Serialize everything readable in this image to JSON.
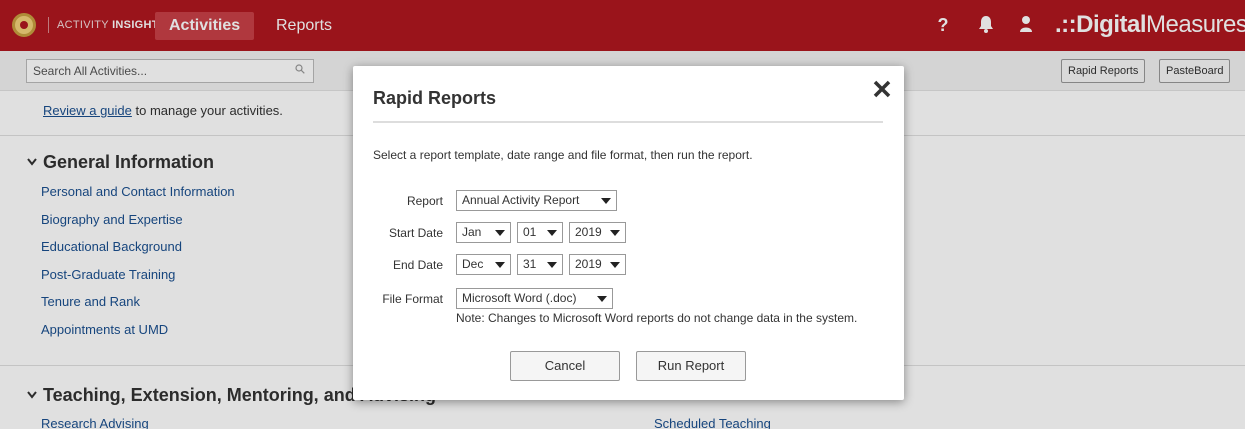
{
  "topbar": {
    "brand_light": "ACTIVITY ",
    "brand_bold": "INSIGHT",
    "nav_active": "Activities",
    "nav_reports": "Reports",
    "help_icon": "?",
    "logo_dots": ".::",
    "logo_digital": "Digital",
    "logo_measures": "Measures",
    "colors": {
      "bar": "#b0171f",
      "active_tab": "#c94047"
    }
  },
  "subbar": {
    "search_placeholder": "Search All Activities...",
    "rapid_reports": "Rapid Reports",
    "pasteboard": "PasteBoard"
  },
  "main": {
    "guide_link": "Review a guide",
    "guide_rest": " to manage your activities.",
    "section1_title": "General Information",
    "section1_links": [
      "Personal and Contact Information",
      "Biography and Expertise",
      "Educational Background",
      "Post-Graduate Training",
      "Tenure and Rank",
      "Appointments at UMD"
    ],
    "section2_title": "Teaching, Extension, Mentoring, and Advising",
    "section2_links_left": [
      "Research Advising"
    ],
    "section2_links_right": [
      "Scheduled Teaching"
    ]
  },
  "modal": {
    "title": "Rapid Reports",
    "description": "Select a report template, date range and file format, then run the report.",
    "report_label": "Report",
    "report_value": "Annual Activity Report",
    "start_label": "Start Date",
    "start_month": "Jan",
    "start_day": "01",
    "start_year": "2019",
    "end_label": "End Date",
    "end_month": "Dec",
    "end_day": "31",
    "end_year": "2019",
    "format_label": "File Format",
    "format_value": "Microsoft Word (.doc)",
    "note": "Note: Changes to Microsoft Word reports do not change data in the system.",
    "cancel": "Cancel",
    "run": "Run Report"
  }
}
